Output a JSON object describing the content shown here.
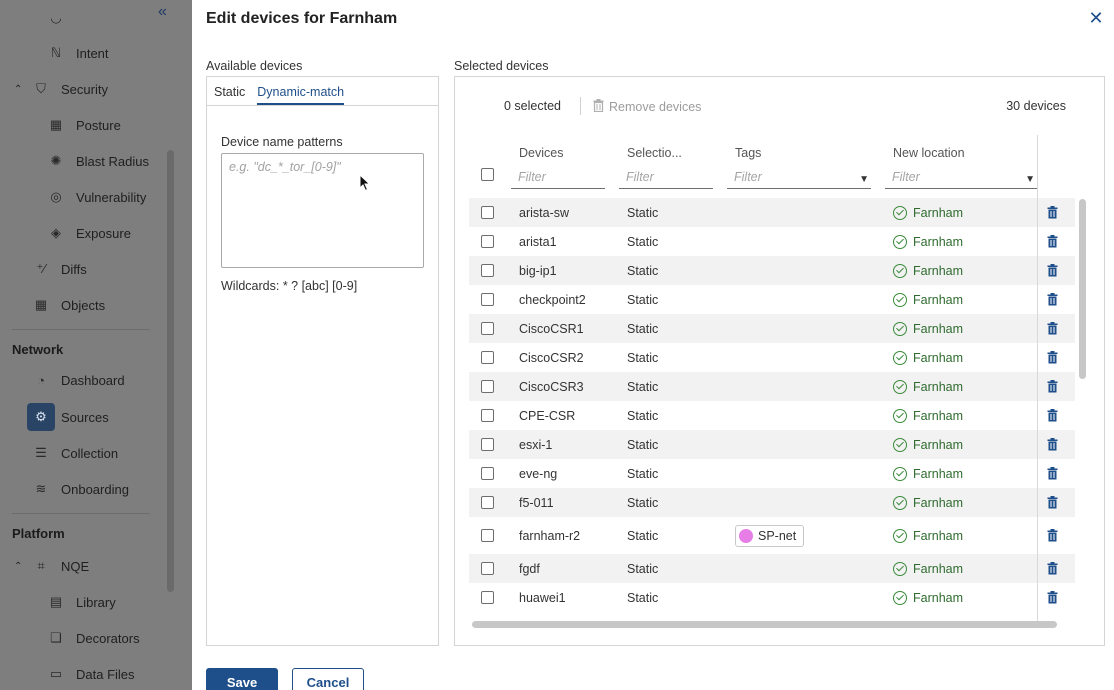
{
  "sidebar": {
    "collapse_icon": "double-chevron-left-icon",
    "items": [
      {
        "label": "Intent",
        "icon": "intent-icon",
        "glyph": "ℕ"
      },
      {
        "label": "Security",
        "icon": "shield-icon",
        "glyph": "⛉"
      },
      {
        "label": "Posture",
        "icon": "posture-icon",
        "glyph": "▦"
      },
      {
        "label": "Blast Radius",
        "icon": "blast-radius-icon",
        "glyph": "✺"
      },
      {
        "label": "Vulnerability",
        "icon": "vulnerability-icon",
        "glyph": "◎"
      },
      {
        "label": "Exposure",
        "icon": "exposure-icon",
        "glyph": "◈"
      },
      {
        "label": "Diffs",
        "icon": "diffs-icon",
        "glyph": "⁺∕"
      },
      {
        "label": "Objects",
        "icon": "objects-icon",
        "glyph": "▦"
      },
      {
        "label": "Dashboard",
        "icon": "dashboard-icon",
        "glyph": "◔"
      },
      {
        "label": "Sources",
        "icon": "sources-icon",
        "glyph": "⚙"
      },
      {
        "label": "Collection",
        "icon": "collection-icon",
        "glyph": "☰"
      },
      {
        "label": "Onboarding",
        "icon": "onboarding-icon",
        "glyph": "≋"
      },
      {
        "label": "NQE",
        "icon": "nqe-icon",
        "glyph": "⌗"
      },
      {
        "label": "Library",
        "icon": "library-icon",
        "glyph": "▤"
      },
      {
        "label": "Decorators",
        "icon": "decorators-icon",
        "glyph": "❏"
      },
      {
        "label": "Data Files",
        "icon": "data-files-icon",
        "glyph": "▭"
      }
    ],
    "sections": {
      "network": "Network",
      "platform": "Platform"
    }
  },
  "modal": {
    "title": "Edit devices for Farnham",
    "close_icon": "close-icon"
  },
  "available": {
    "label": "Available devices",
    "tabs": [
      "Static",
      "Dynamic-match"
    ],
    "active_tab": "Dynamic-match",
    "pattern_label": "Device name patterns",
    "pattern_placeholder": "e.g. \"dc_*_tor_[0-9]\"",
    "pattern_value": "",
    "wildcards": "Wildcards: * ? [abc] [0-9]"
  },
  "selected": {
    "label": "Selected devices",
    "selected_count": "0 selected",
    "remove_label": "Remove devices",
    "total_count": "30 devices",
    "columns": {
      "devices": "Devices",
      "selection": "Selectio...",
      "tags": "Tags",
      "new_location": "New location"
    },
    "filter_placeholder": "Filter",
    "rows": [
      {
        "device": "arista-sw",
        "selection": "Static",
        "tag": "",
        "location": "Farnham"
      },
      {
        "device": "arista1",
        "selection": "Static",
        "tag": "",
        "location": "Farnham"
      },
      {
        "device": "big-ip1",
        "selection": "Static",
        "tag": "",
        "location": "Farnham"
      },
      {
        "device": "checkpoint2",
        "selection": "Static",
        "tag": "",
        "location": "Farnham"
      },
      {
        "device": "CiscoCSR1",
        "selection": "Static",
        "tag": "",
        "location": "Farnham"
      },
      {
        "device": "CiscoCSR2",
        "selection": "Static",
        "tag": "",
        "location": "Farnham"
      },
      {
        "device": "CiscoCSR3",
        "selection": "Static",
        "tag": "",
        "location": "Farnham"
      },
      {
        "device": "CPE-CSR",
        "selection": "Static",
        "tag": "",
        "location": "Farnham"
      },
      {
        "device": "esxi-1",
        "selection": "Static",
        "tag": "",
        "location": "Farnham"
      },
      {
        "device": "eve-ng",
        "selection": "Static",
        "tag": "",
        "location": "Farnham"
      },
      {
        "device": "f5-011",
        "selection": "Static",
        "tag": "",
        "location": "Farnham"
      },
      {
        "device": "farnham-r2",
        "selection": "Static",
        "tag": "SP-net",
        "tag_color": "#e77de7",
        "location": "Farnham"
      },
      {
        "device": "fgdf",
        "selection": "Static",
        "tag": "",
        "location": "Farnham"
      },
      {
        "device": "huawei1",
        "selection": "Static",
        "tag": "",
        "location": "Farnham"
      }
    ]
  },
  "footer": {
    "save": "Save",
    "cancel": "Cancel"
  },
  "colors": {
    "accent": "#1f4f8a",
    "location_ok": "#3a8a3a",
    "backdrop": "#7f7f7f"
  }
}
